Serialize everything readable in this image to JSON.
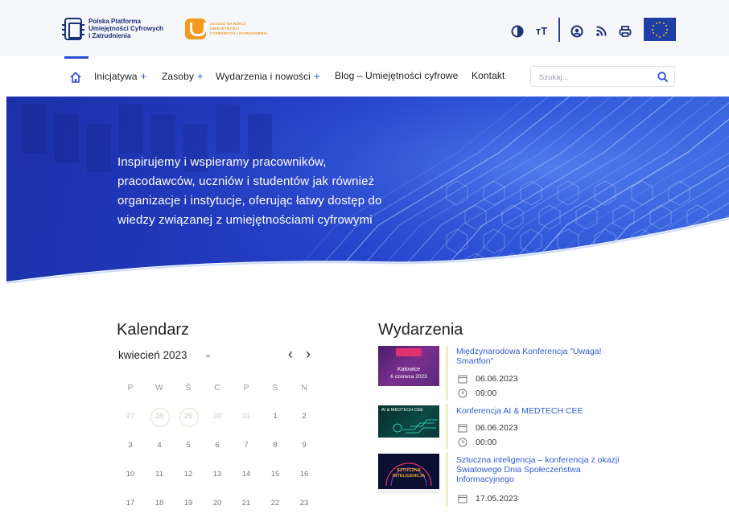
{
  "header": {
    "logo_lines": [
      "Polska Platforma",
      "Umiejętności Cyfrowych",
      "i Zatrudnienia"
    ],
    "partner_lines": [
      "SOJUSZ NA RZECZ",
      "UMIEJĘTNOŚCI",
      "CYFROWYCH I ZATRUDNIENIA"
    ],
    "tools": [
      "contrast-icon",
      "font-size-icon",
      "account-icon",
      "rss-icon",
      "print-icon"
    ],
    "font_size_label": "тT"
  },
  "nav": {
    "items": [
      {
        "label": "Inicjatywa",
        "expandable": true
      },
      {
        "label": "Zasoby",
        "expandable": true
      },
      {
        "label": "Wydarzenia i nowości",
        "expandable": true
      },
      {
        "label": "Blog – Umiejętności cyfrowe",
        "expandable": false
      },
      {
        "label": "Kontakt",
        "expandable": false
      }
    ],
    "plus": "+",
    "search_placeholder": "Szukaj..."
  },
  "hero": {
    "lines": [
      "Inspirujemy i wspieramy pracowników,",
      "pracodawców, uczniów i studentów jak również",
      "organizacje i instytucje, oferując łatwy dostęp do",
      "wiedzy związanej z umiejętnościami cyfrowymi"
    ]
  },
  "calendar": {
    "title": "Kalendarz",
    "month": "kwiecień 2023",
    "prev": "‹",
    "next": "›",
    "weekdays": [
      "P",
      "W",
      "Ś",
      "C",
      "P",
      "S",
      "N"
    ],
    "weeks": [
      [
        "27",
        "28",
        "29",
        "30",
        "31",
        "1",
        "2"
      ],
      [
        "3",
        "4",
        "5",
        "6",
        "7",
        "8",
        "9"
      ],
      [
        "10",
        "11",
        "12",
        "13",
        "14",
        "15",
        "16"
      ],
      [
        "17",
        "18",
        "19",
        "20",
        "21",
        "22",
        "23"
      ]
    ]
  },
  "events": {
    "title": "Wydarzenia",
    "items": [
      {
        "title": "Międzynarodowa Konferencja \"Uwaga! Smartfon\"",
        "date": "06.06.2023",
        "time": "09:00",
        "thumb_lines": [
          "Katowice",
          "6 czerwca 2023"
        ]
      },
      {
        "title": "Konferencja AI & MEDTECH CEE",
        "date": "06.06.2023",
        "time": "00:00",
        "thumb_lines": [
          "AI & MEDTECH CEE"
        ]
      },
      {
        "title": "Sztuczna inteligencja – konferencja z okazji Światowego Dnia Społeczeństwa Informacyjnego",
        "date": "17.05.2023",
        "time": "",
        "thumb_lines": [
          "SZTUCZNA",
          "INTELIGENCJA"
        ]
      }
    ]
  },
  "colors": {
    "brand_navy": "#1c2f7a",
    "accent_blue": "#2a4fd1",
    "sojusz_orange": "#f39a1e",
    "link": "#2f5bd6"
  }
}
